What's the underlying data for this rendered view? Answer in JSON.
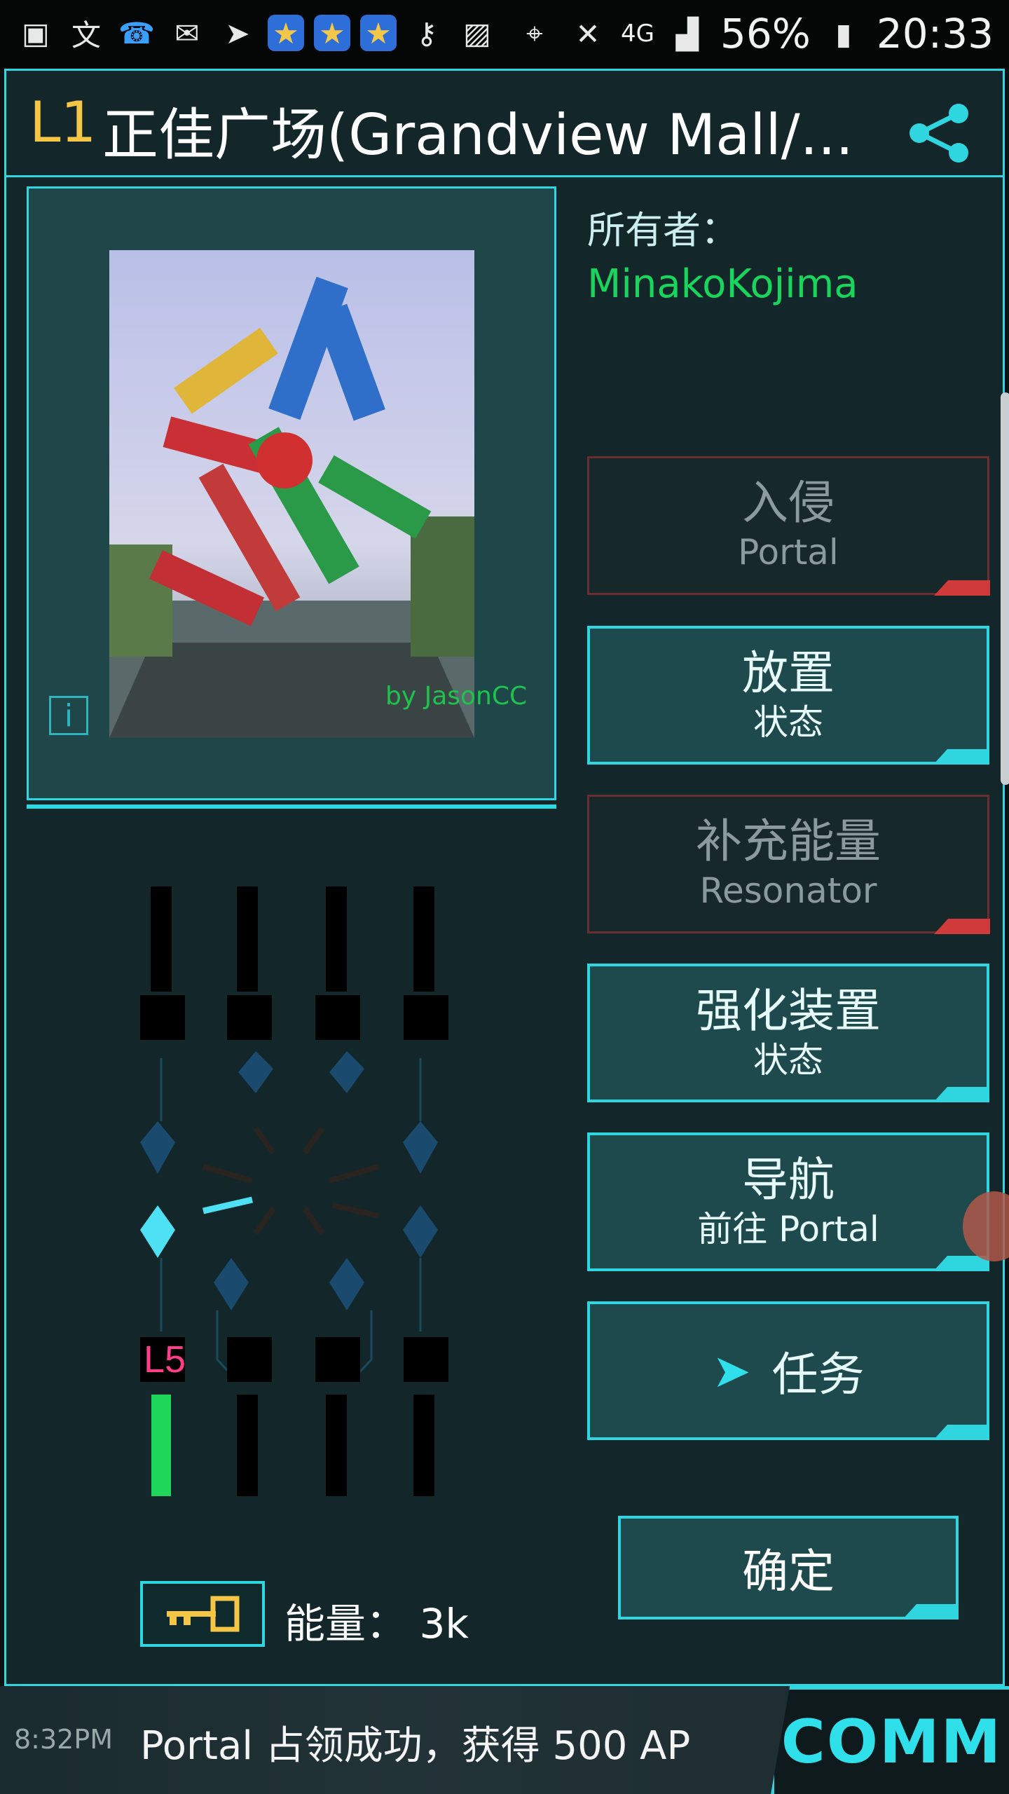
{
  "status_bar": {
    "icons": [
      "message-icon",
      "translate-icon",
      "notification-icon",
      "mail-icon",
      "telegram-icon",
      "star-app-icon",
      "star-app-icon",
      "star-app-icon",
      "key-icon",
      "image-icon"
    ],
    "right": {
      "network": "4G",
      "battery": "56%",
      "time": "20:33"
    }
  },
  "portal": {
    "level": "L1",
    "title": "正佳广场(Grandview Mall/...",
    "owner_label": "所有者：",
    "owner_name": "MinakoKojima",
    "photo_credit": "by JasonCC",
    "info_label": "i"
  },
  "actions": [
    {
      "id": "hack",
      "line1": "入侵",
      "line2": "Portal",
      "enabled": false
    },
    {
      "id": "deploy",
      "line1": "放置",
      "line2": "状态",
      "enabled": true
    },
    {
      "id": "recharge",
      "line1": "补充能量",
      "line2": "Resonator",
      "enabled": false
    },
    {
      "id": "mods",
      "line1": "强化装置",
      "line2": "状态",
      "enabled": true
    },
    {
      "id": "navigate",
      "line1": "导航",
      "line2": "前往 Portal",
      "enabled": true
    },
    {
      "id": "missions",
      "line1": "任务",
      "line2": "",
      "enabled": true
    }
  ],
  "confirm_label": "确定",
  "resonators": {
    "level_badge": "L5",
    "energy_label": "能量：",
    "energy_value": "3k"
  },
  "bottom": {
    "time": "8:32PM",
    "message": "Portal 占领成功，获得 500 AP",
    "comm_label": "COMM"
  },
  "colors": {
    "accent": "#2fd6df",
    "owner_green": "#18d65b",
    "level_yellow": "#f5c645",
    "disabled_red": "#d13a3a",
    "badge_pink": "#ff3d8a"
  }
}
